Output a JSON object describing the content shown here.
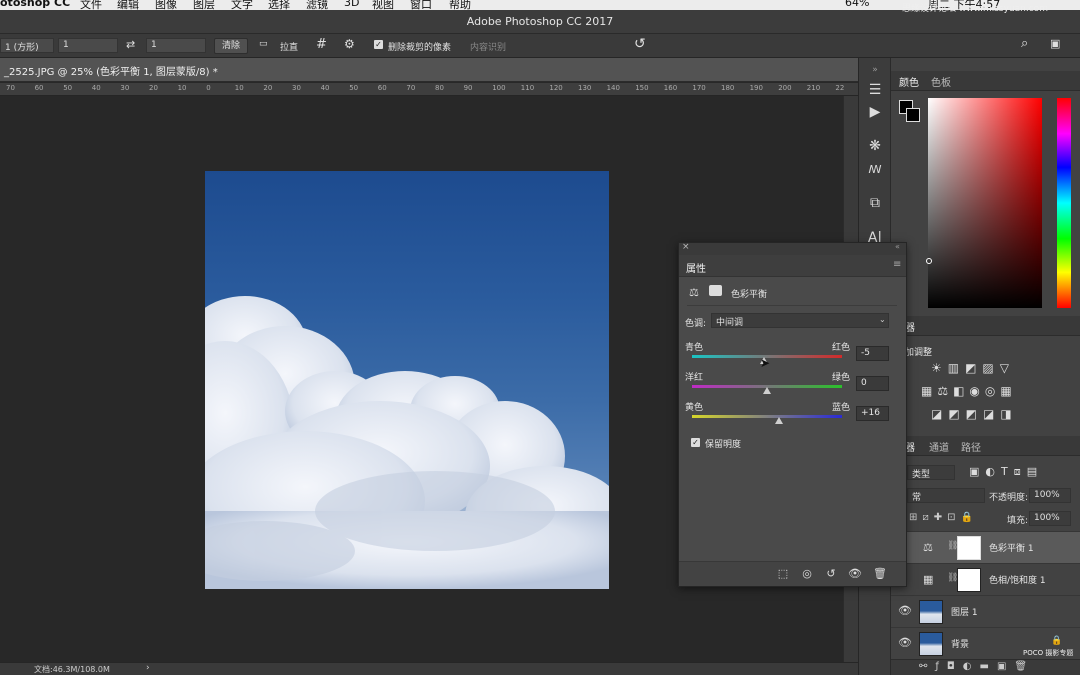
{
  "menubar": {
    "items": [
      "otoshop CC",
      "文件",
      "编辑",
      "图像",
      "图层",
      "文字",
      "选择",
      "滤镜",
      "3D",
      "视图",
      "窗口",
      "帮助"
    ],
    "status_right": [
      "64%",
      "周二 下午4:57"
    ],
    "watermark": "思缘设计论坛 www.missyuan.com"
  },
  "titlebar": {
    "title": "Adobe Photoshop CC 2017"
  },
  "options": {
    "ratio_select": "1 (方形)",
    "ratio_w": "1",
    "ratio_h": "1",
    "clear_button": "清除",
    "straighten_label": "拉直",
    "delete_cropped_label": "删除裁剪的像素",
    "content_aware_label": "内容识别"
  },
  "document": {
    "tab_title": "_2525.JPG @ 25% (色彩平衡 1, 图层蒙版/8) *",
    "ruler_marks": [
      "70",
      "60",
      "50",
      "40",
      "30",
      "20",
      "10",
      "0",
      "10",
      "20",
      "30",
      "40",
      "50",
      "60",
      "70",
      "80",
      "90",
      "100",
      "110",
      "120",
      "130",
      "140",
      "150",
      "160",
      "170",
      "180",
      "190",
      "200",
      "210",
      "22"
    ],
    "status_text": "文档:46.3M/108.0M"
  },
  "properties_panel": {
    "tab_label": "属性",
    "adjustment_title": "色彩平衡",
    "tone_label": "色调:",
    "tone_value": "中间调",
    "sliders": [
      {
        "left_label": "青色",
        "right_label": "红色",
        "value": "-5"
      },
      {
        "left_label": "洋红",
        "right_label": "绿色",
        "value": "0"
      },
      {
        "left_label": "黄色",
        "right_label": "蓝色",
        "value": "+16"
      }
    ],
    "preserve_luminosity_label": "保留明度"
  },
  "color_panel": {
    "tabs": [
      "颜色",
      "色板"
    ]
  },
  "adjustments_panel": {
    "tab_partial": "器",
    "add_label": "加调整"
  },
  "layers_panel": {
    "tabs": [
      "器",
      "通道",
      "路径"
    ],
    "filter_select": "类型",
    "blend_mode": "常",
    "opacity_label": "不透明度:",
    "opacity_value": "100%",
    "fill_label": "填充:",
    "fill_value": "100%",
    "layers": [
      {
        "name": "色彩平衡 1",
        "kind": "adjustment"
      },
      {
        "name": "色相/饱和度 1",
        "kind": "adjustment"
      },
      {
        "name": "图层 1",
        "kind": "image"
      },
      {
        "name": "背景",
        "kind": "image"
      }
    ],
    "poco_watermark": "POCO 摄影专题"
  }
}
